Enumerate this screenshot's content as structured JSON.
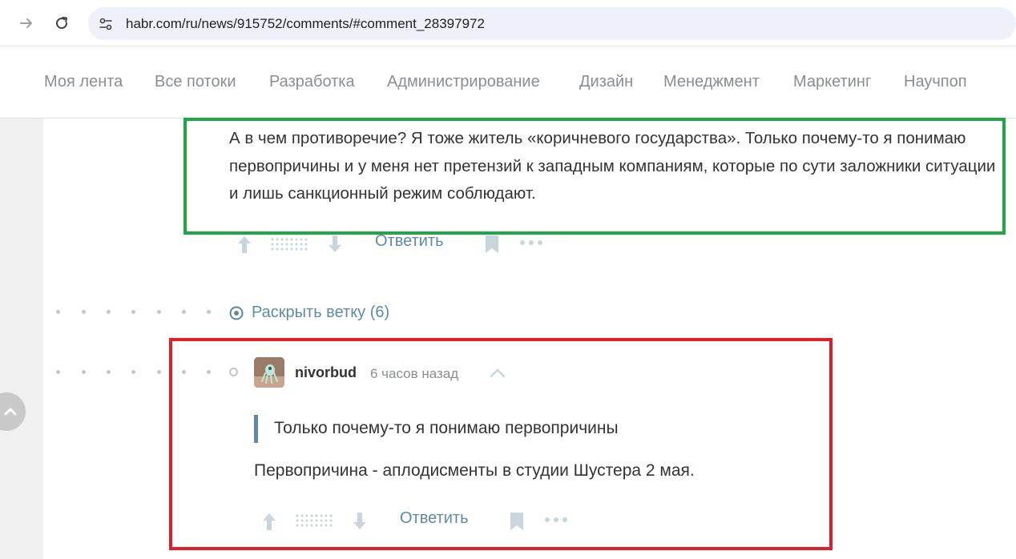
{
  "browser": {
    "url": "habr.com/ru/news/915752/comments/#comment_28397972"
  },
  "nav": {
    "items": [
      "Моя лента",
      "Все потоки",
      "Разработка",
      "Администрирование",
      "Дизайн",
      "Менеджмент",
      "Маркетинг",
      "Научпоп"
    ]
  },
  "comment1": {
    "text": "А в чем противоречие? Я тоже житель «коричневого государства». Только почему-то я понимаю первопричины и у меня нет претензий к западным компаниям, которые по сути заложники ситуации и лишь санкционный режим соблюдают.",
    "reply_label": "Ответить"
  },
  "thread": {
    "expand_label": "Раскрыть ветку (6)"
  },
  "comment2": {
    "author": "nivorbud",
    "time": "6 часов назад",
    "quote": "Только почему-то я понимаю первопричины",
    "text": "Первопричина - аплодисменты в студии Шустера 2 мая.",
    "reply_label": "Ответить"
  },
  "icons": {
    "back": "arrow-right-icon",
    "reload": "reload-icon",
    "site_info": "tune-icon",
    "upvote": "arrow-up-icon",
    "downvote": "arrow-down-icon",
    "bookmark": "bookmark-icon",
    "more": "more-icon",
    "collapse": "chevron-up-icon",
    "expand": "target-icon",
    "scroll_top": "chevron-up-icon"
  },
  "colors": {
    "link": "#5e8aa6",
    "nav_text": "#8a8e91",
    "highlight_green": "#20a745",
    "highlight_red": "#e01e2b"
  }
}
